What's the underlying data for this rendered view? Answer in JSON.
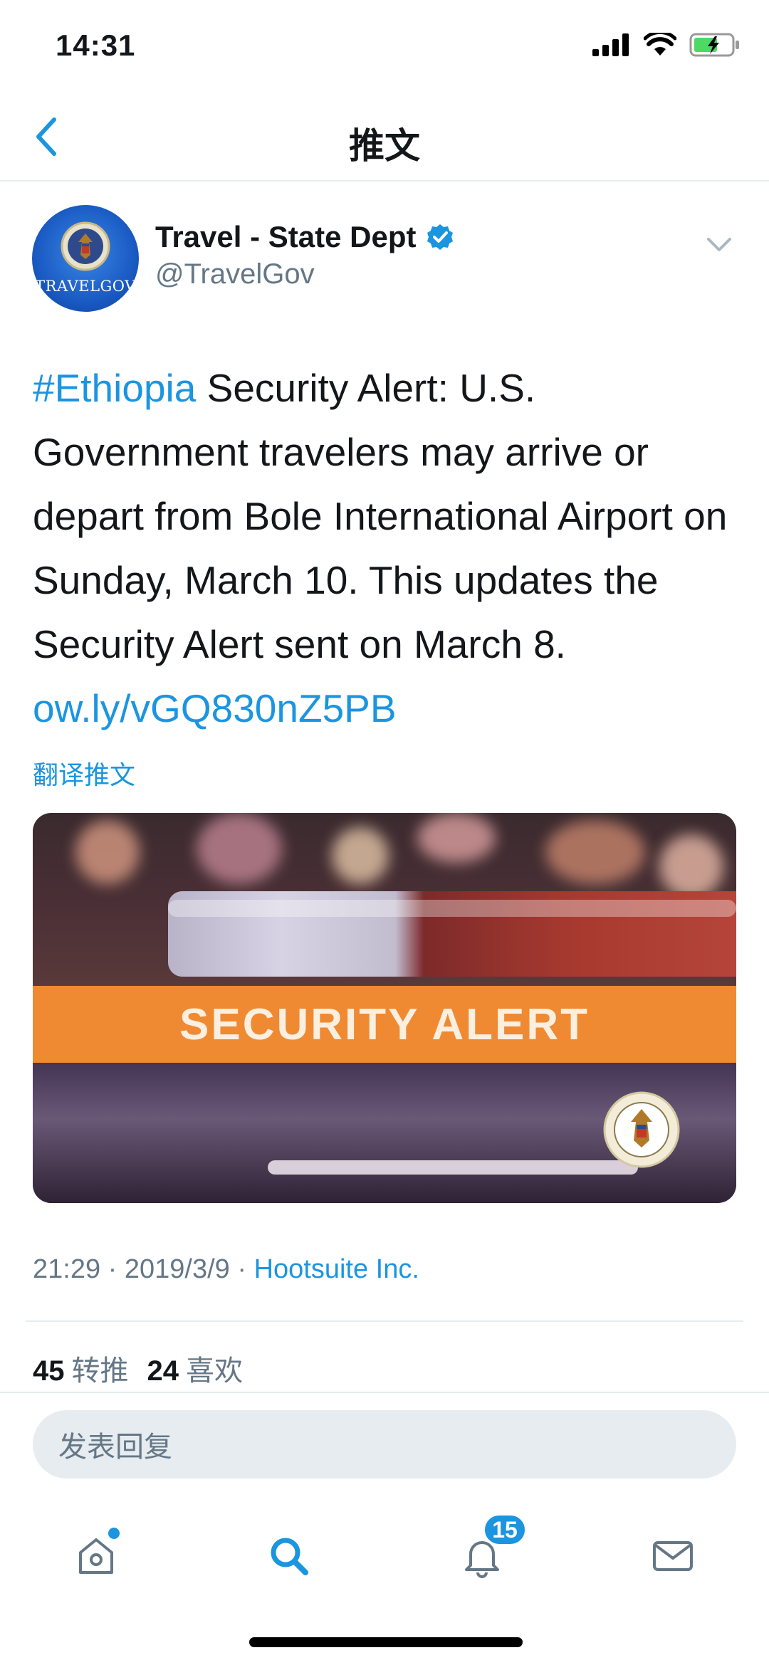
{
  "status_bar": {
    "time": "14:31"
  },
  "nav": {
    "title": "推文"
  },
  "tweet": {
    "avatar_text": "TRAVELGOV",
    "display_name": "Travel - State Dept",
    "handle": "@TravelGov",
    "text": {
      "hashtag": "#Ethiopia",
      "body": " Security Alert: U.S. Government travelers may arrive or depart from Bole International Airport on Sunday, March 10. This updates the Security Alert sent on March 8. ",
      "link": "ow.ly/vGQ830nZ5PB"
    },
    "translate_label": "翻译推文",
    "media": {
      "banner_text": "SECURITY ALERT"
    },
    "meta": {
      "time": "21:29",
      "sep1": " · ",
      "date": "2019/3/9",
      "sep2": " · ",
      "source": "Hootsuite Inc."
    },
    "stats": {
      "retweets_count": "45",
      "retweets_label": "转推",
      "likes_count": "24",
      "likes_label": "喜欢"
    }
  },
  "reply": {
    "placeholder": "发表回复"
  },
  "tab_bar": {
    "notifications_badge": "15",
    "icons": [
      "home-icon",
      "search-icon",
      "bell-icon",
      "mail-icon"
    ]
  },
  "colors": {
    "accent": "#1b95e0",
    "alert_band": "#ef8a33",
    "secondary_text": "#657786"
  }
}
